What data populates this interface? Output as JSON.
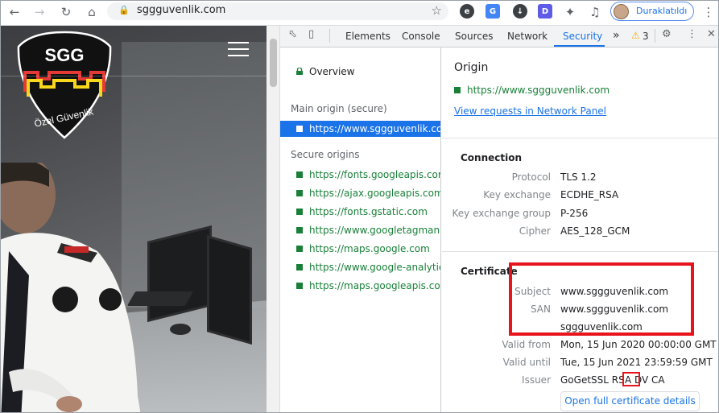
{
  "browser": {
    "url": "sggguvenlik.com",
    "profile_label": "Duraklatıldı",
    "icons": [
      "back-icon",
      "forward-icon",
      "reload-icon",
      "home-icon",
      "lock-icon",
      "star-icon",
      "extension-icon",
      "puzzle-icon",
      "media-icon",
      "menu-icon"
    ]
  },
  "site": {
    "logo_text": "SGG",
    "logo_subtext": "Özel Güvenlik",
    "badge_text": "SGG"
  },
  "devtools": {
    "tabs": [
      "Elements",
      "Console",
      "Sources",
      "Network",
      "Security"
    ],
    "active_tab": "Security",
    "more_label": "»",
    "warnings_count": "3",
    "left": {
      "overview": "Overview",
      "main_origin_header": "Main origin (secure)",
      "main_origin": "https://www.sggguvenlik.com",
      "secure_origins_header": "Secure origins",
      "secure_origins": [
        "https://fonts.googleapis.com",
        "https://ajax.googleapis.com",
        "https://fonts.gstatic.com",
        "https://www.googletagmanager.com",
        "https://maps.google.com",
        "https://www.google-analytics.com",
        "https://maps.googleapis.com"
      ]
    },
    "right": {
      "origin_title": "Origin",
      "origin_url": "https://www.sggguvenlik.com",
      "view_requests": "View requests in Network Panel",
      "connection_title": "Connection",
      "connection": [
        {
          "k": "Protocol",
          "v": "TLS 1.2"
        },
        {
          "k": "Key exchange",
          "v": "ECDHE_RSA"
        },
        {
          "k": "Key exchange group",
          "v": "P-256"
        },
        {
          "k": "Cipher",
          "v": "AES_128_GCM"
        }
      ],
      "certificate_title": "Certificate",
      "certificate": [
        {
          "k": "Subject",
          "v": "www.sggguvenlik.com"
        },
        {
          "k": "SAN",
          "v": "www.sggguvenlik.com"
        },
        {
          "k": "",
          "v": "sggguvenlik.com"
        },
        {
          "k": "Valid from",
          "v": "Mon, 15 Jun 2020 00:00:00 GMT"
        },
        {
          "k": "Valid until",
          "v": "Tue, 15 Jun 2021 23:59:59 GMT"
        },
        {
          "k": "Issuer",
          "v": "GoGetSSL RSA DV CA"
        }
      ],
      "open_cert_button": "Open full certificate details"
    }
  }
}
